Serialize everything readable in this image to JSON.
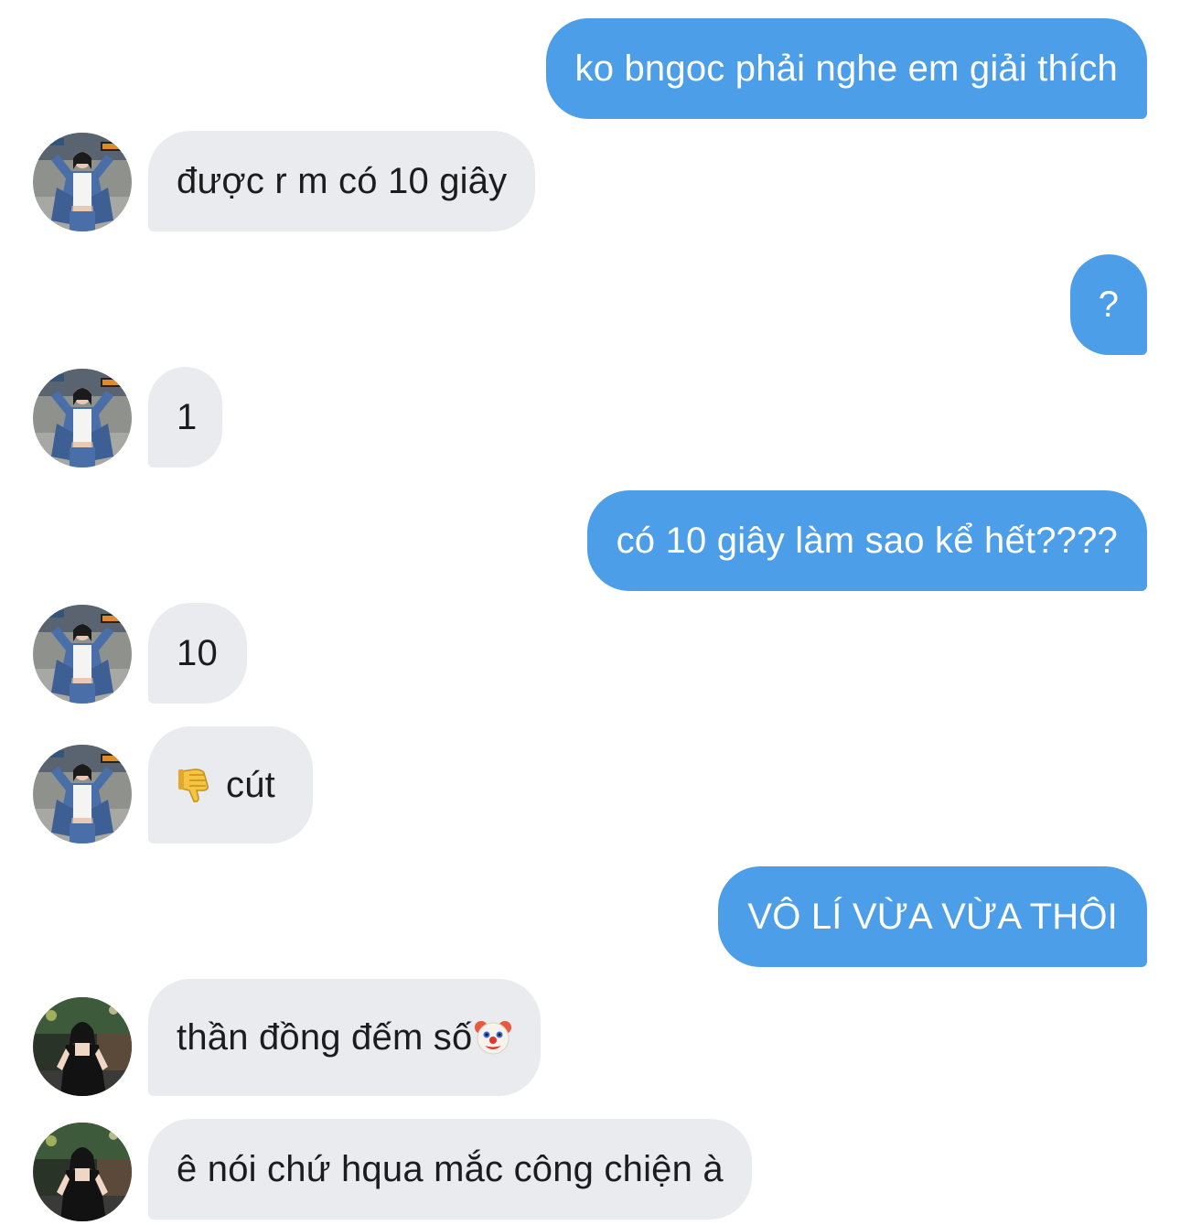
{
  "conversation": {
    "messages": [
      {
        "side": "sent",
        "text": "ko bngoc phải nghe em giải thích"
      },
      {
        "side": "received",
        "text": "được r m có 10 giây",
        "avatar": "avatar-photo-denim-jacket"
      },
      {
        "side": "sent",
        "text": "?"
      },
      {
        "side": "received",
        "text": "1",
        "avatar": "avatar-photo-denim-jacket"
      },
      {
        "side": "sent",
        "text": "có 10 giây làm sao kể hết????"
      },
      {
        "side": "received",
        "text": "10",
        "avatar": "avatar-photo-denim-jacket"
      },
      {
        "side": "received",
        "text": "cút",
        "emoji": "thumbs-down-icon",
        "avatar": "avatar-photo-denim-jacket"
      },
      {
        "side": "sent",
        "text": "VÔ LÍ VỪA VỪA THÔI"
      },
      {
        "side": "received",
        "text": "thần đồng đếm số",
        "emoji": "clown-face-icon",
        "avatar": "avatar-photo-black-dress"
      },
      {
        "side": "received",
        "text": "ê nói chứ hqua mắc công chiện à",
        "avatar": "avatar-photo-black-dress"
      }
    ]
  },
  "colors": {
    "sent_bubble": "#4d9ee8",
    "received_bubble": "#e9ebef",
    "sent_text": "#ffffff",
    "received_text": "#1c1c1e"
  }
}
